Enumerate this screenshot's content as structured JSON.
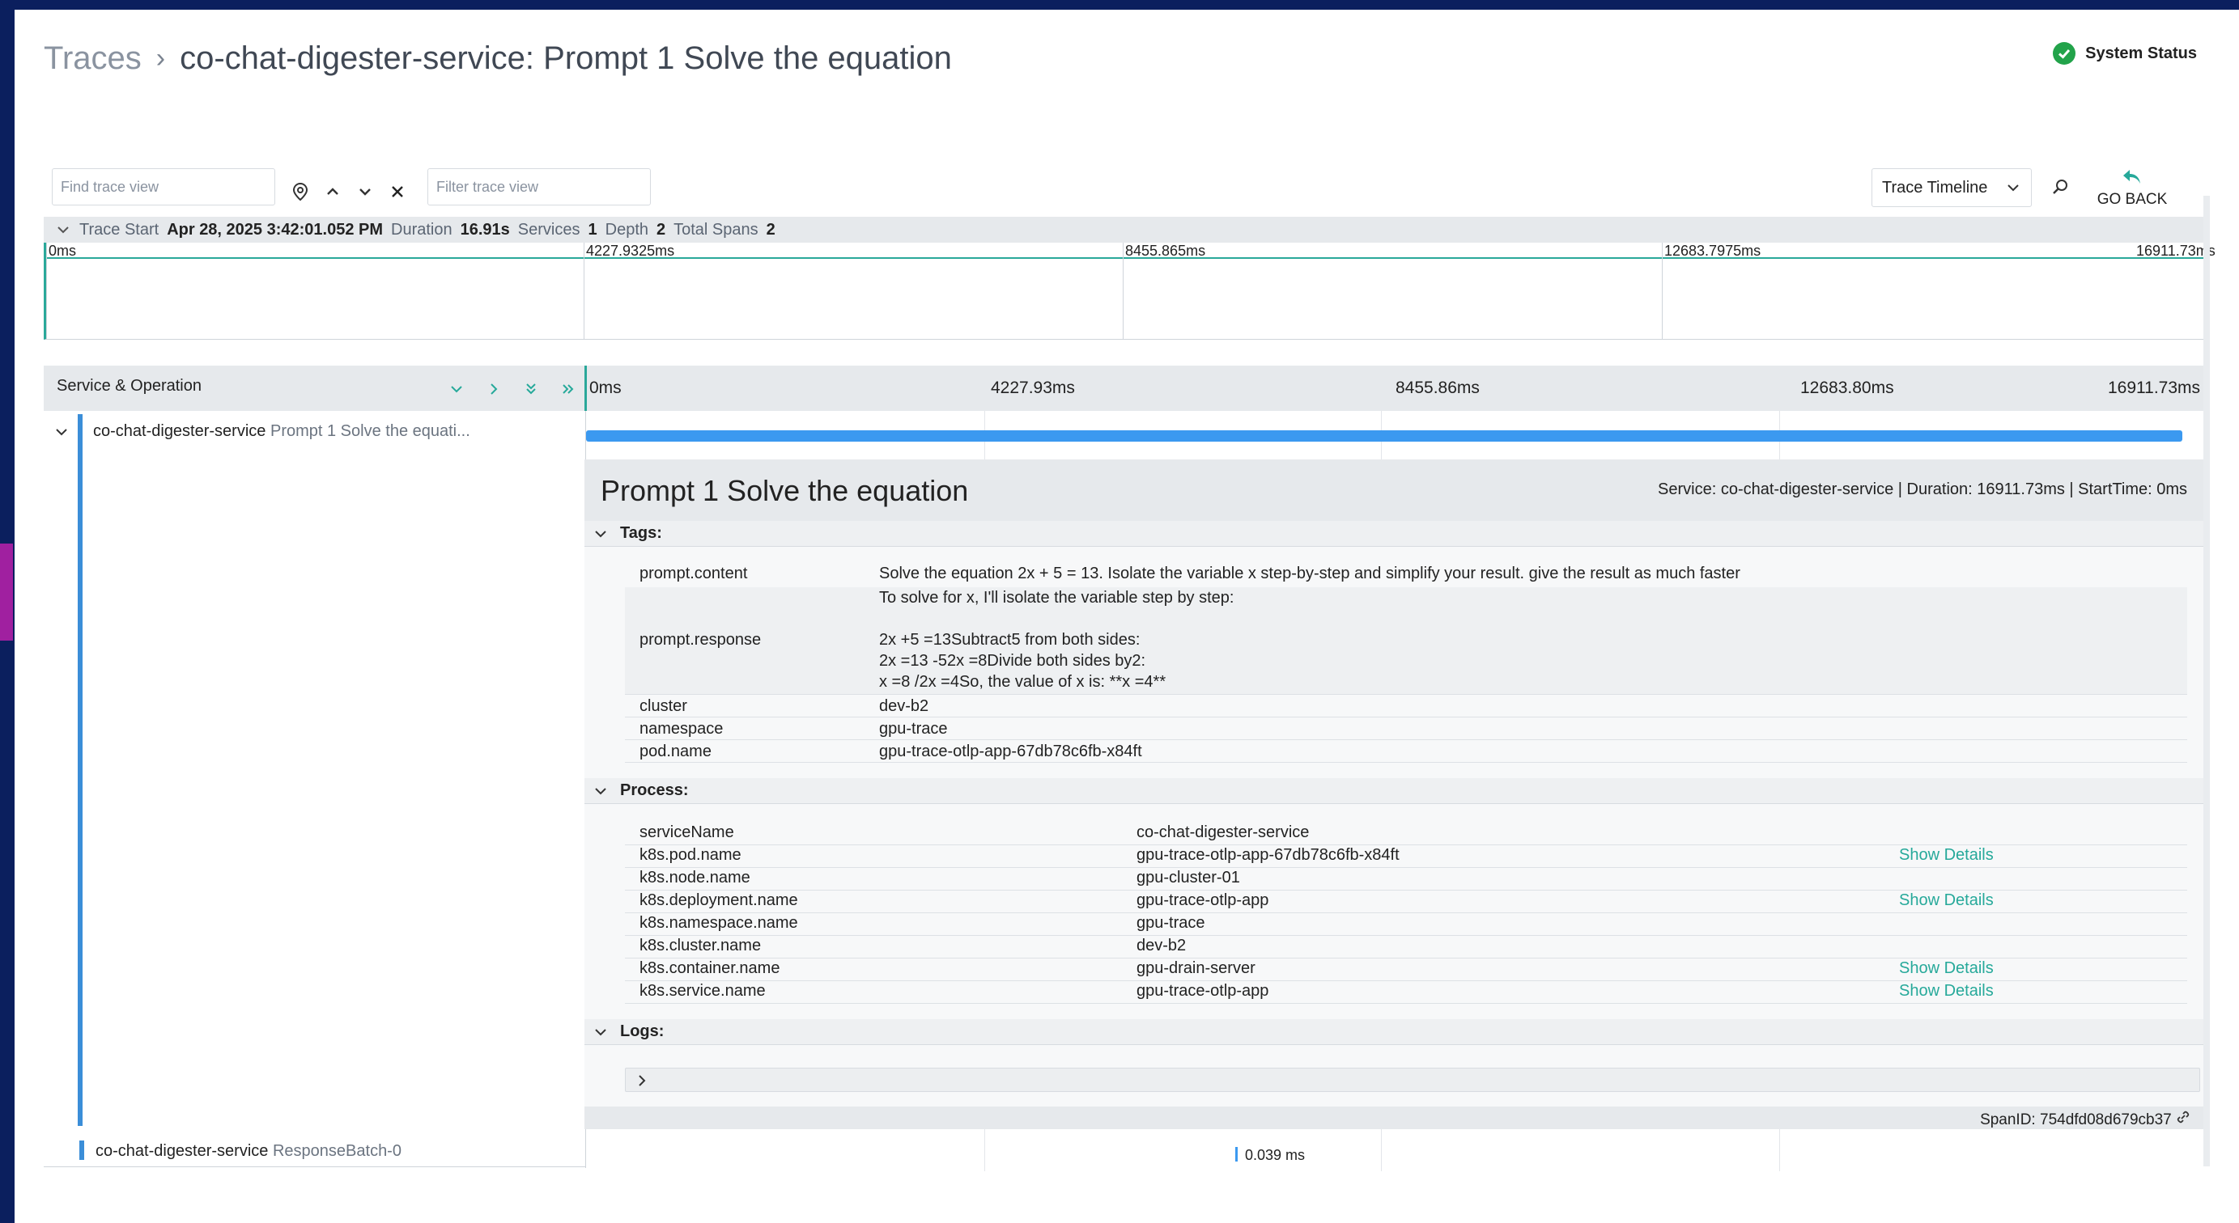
{
  "breadcrumb": {
    "root": "Traces",
    "separator": "›",
    "title": "co-chat-digester-service: Prompt 1 Solve the equation"
  },
  "system_status": {
    "label": "System Status",
    "color": "#22a34a"
  },
  "toolbar": {
    "find_placeholder": "Find trace view",
    "filter_placeholder": "Filter trace view",
    "view_select": "Trace Timeline",
    "go_back": "GO BACK"
  },
  "summary": {
    "trace_start_label": "Trace Start",
    "trace_start": "Apr 28, 2025 3:42:01.052 PM",
    "duration_label": "Duration",
    "duration": "16.91s",
    "services_label": "Services",
    "services": "1",
    "depth_label": "Depth",
    "depth": "2",
    "total_spans_label": "Total Spans",
    "total_spans": "2"
  },
  "minimap_ticks": [
    "0ms",
    "4227.9325ms",
    "8455.865ms",
    "12683.7975ms",
    "16911.73ms"
  ],
  "header": {
    "service_operation": "Service & Operation",
    "ticks": [
      "0ms",
      "4227.93ms",
      "8455.86ms",
      "12683.80ms",
      "16911.73ms"
    ]
  },
  "span": {
    "service": "co-chat-digester-service",
    "operation": "Prompt 1 Solve the equati..."
  },
  "detail": {
    "title": "Prompt 1 Solve the equation",
    "meta": "Service: co-chat-digester-service | Duration: 16911.73ms | StartTime: 0ms",
    "tags_label": "Tags:",
    "tags": [
      {
        "key": "prompt.content",
        "value": "Solve the equation 2x + 5 = 13. Isolate the variable x step-by-step and simplify your result. give the result as much faster"
      },
      {
        "key": "prompt.response",
        "value_lines": [
          "To solve for x, I'll isolate the variable step by step:",
          "",
          "2x +5 =13Subtract5 from both sides:",
          "2x =13 -52x =8Divide both sides by2:",
          "x =8 /2x =4So, the value of x is: **x =4**"
        ]
      },
      {
        "key": "cluster",
        "value": "dev-b2"
      },
      {
        "key": "namespace",
        "value": "gpu-trace"
      },
      {
        "key": "pod.name",
        "value": "gpu-trace-otlp-app-67db78c6fb-x84ft"
      }
    ],
    "process_label": "Process:",
    "process": [
      {
        "key": "serviceName",
        "value": "co-chat-digester-service",
        "link": ""
      },
      {
        "key": "k8s.pod.name",
        "value": "gpu-trace-otlp-app-67db78c6fb-x84ft",
        "link": "Show Details"
      },
      {
        "key": "k8s.node.name",
        "value": "gpu-cluster-01",
        "link": ""
      },
      {
        "key": "k8s.deployment.name",
        "value": "gpu-trace-otlp-app",
        "link": "Show Details"
      },
      {
        "key": "k8s.namespace.name",
        "value": "gpu-trace",
        "link": ""
      },
      {
        "key": "k8s.cluster.name",
        "value": "dev-b2",
        "link": ""
      },
      {
        "key": "k8s.container.name",
        "value": "gpu-drain-server",
        "link": "Show Details"
      },
      {
        "key": "k8s.service.name",
        "value": "gpu-trace-otlp-app",
        "link": "Show Details"
      }
    ],
    "logs_label": "Logs:",
    "span_id_label": "SpanID:",
    "span_id": "754dfd08d679cb37"
  },
  "child_span": {
    "service": "co-chat-digester-service",
    "operation": "ResponseBatch-0",
    "duration": "0.039 ms"
  },
  "colors": {
    "accent": "#2aa89a",
    "bar": "#3b99f0",
    "link": "#26a99a"
  }
}
